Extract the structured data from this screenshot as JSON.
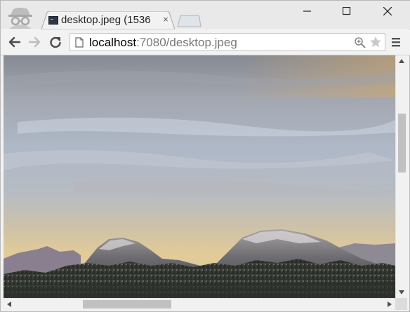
{
  "tab": {
    "title": "desktop.jpeg (1536",
    "close_glyph": "×"
  },
  "window_controls": {
    "minimize_glyph": "—",
    "maximize_glyph": "☐",
    "close_glyph": "✕"
  },
  "address_bar": {
    "host": "localhost",
    "rest": ":7080/desktop.jpeg"
  },
  "icons": {
    "incognito": "incognito-icon",
    "favicon": "terminal-icon",
    "back": "arrow-left-icon",
    "forward": "arrow-right-icon",
    "reload": "reload-icon",
    "page": "page-icon",
    "zoom": "zoom-icon",
    "star": "star-icon",
    "menu": "hamburger-menu-icon"
  },
  "colors": {
    "sky_top": "#8b8f98",
    "sky_mid": "#a9b3c2",
    "horizon": "#dcc79a",
    "mountain": "#5d5d66"
  }
}
